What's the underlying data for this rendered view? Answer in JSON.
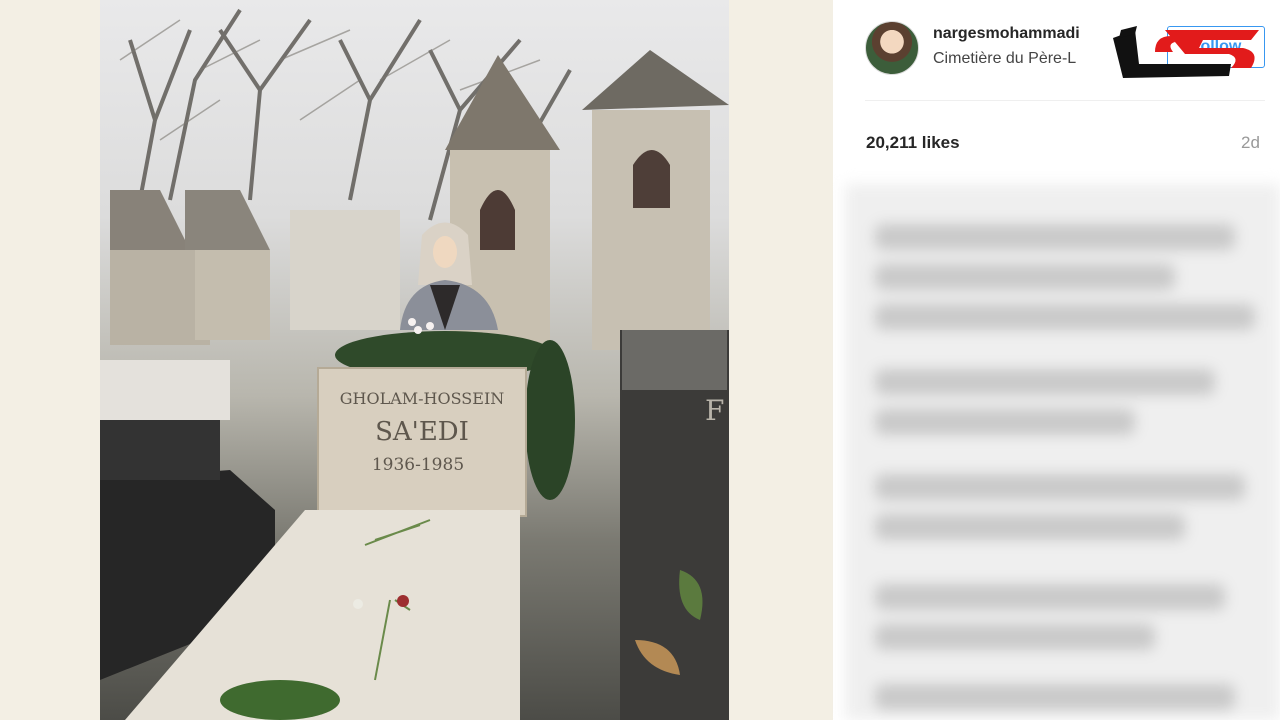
{
  "post": {
    "username": "nargesmohammadi",
    "location": "Cimetière du Père-L",
    "follow_label": "Follow",
    "likes": "20,211 likes",
    "age": "2d"
  },
  "photo": {
    "grave_line1": "GHOLAM-HOSSEIN",
    "grave_line2": "SA'EDI",
    "grave_line3": "1936-1985",
    "tomb_letter": "F"
  },
  "colors": {
    "follow_blue": "#3897f0",
    "logo_red": "#e21b1b",
    "logo_black": "#111111"
  },
  "icons": {
    "logo": "brand-logo"
  }
}
